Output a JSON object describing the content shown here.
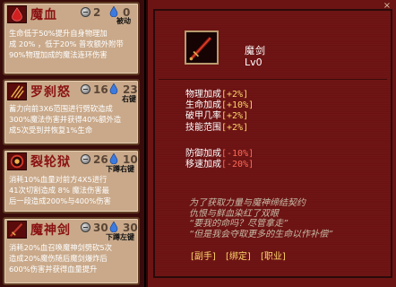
{
  "skills": [
    {
      "name": "魔血",
      "cost1": "2",
      "cost2": "0",
      "trigger": "被动",
      "desc": [
        "生命低于50%提升自身物理加",
        "成 20% ，低于20% 普攻额外附带",
        "90%物理加成的魔法连环伤害"
      ],
      "icon": "blood-drop-icon"
    },
    {
      "name": "罗刹怒",
      "cost1": "16",
      "cost2": "23",
      "trigger": "右键",
      "desc": [
        "蓄力向前3X6范围进行劈砍造成",
        "300%魔法伤害并获得40%额外造",
        "成5次受到并恢复1%生命"
      ],
      "icon": "claw-slash-icon"
    },
    {
      "name": "裂轮狱",
      "cost1": "26",
      "cost2": "10",
      "trigger": "下蹲右键",
      "desc": [
        "消耗10%血量对前方4X5进行",
        "41次切割造成 8% 魔法伤害最",
        "后一段造成200%与400%伤害"
      ],
      "icon": "spinning-wheel-icon"
    },
    {
      "name": "魔神剑",
      "cost1": "30",
      "cost2": "30",
      "trigger": "下蹲左键",
      "desc": [
        "消耗20%血召唤魔神剑劈砍5次",
        "造成20%魔伤随后魔剑爆炸后",
        "600%伤害并获得血量提升"
      ],
      "icon": "demon-sword-icon"
    }
  ],
  "item": {
    "name": "魔剑",
    "level": "Lv0",
    "stats_positive": [
      "物理加成[+2%]",
      "生命加成[+10%]",
      "破甲几率[+2%]",
      "技能范围[+2%]"
    ],
    "stats_negative": [
      "防御加成[-10%]",
      "移速加成[-20%]"
    ],
    "lore": [
      "为了获取力量与魔神缔结契约",
      "仇恨与鲜血染红了双眼",
      "“要我的命吗？尽管拿走”",
      "“但是我会夺取更多的生命以作补偿”"
    ],
    "tags": [
      "[副手]",
      "[绑定]",
      "[职业]"
    ],
    "close": "×"
  },
  "colors": {
    "card_bg": "#c9a98a",
    "skill_name": "#8a1212",
    "panel_bg": "#6c1414",
    "stat_positive": "#ffd66a",
    "stat_negative": "#ff6a5a",
    "lore": "#c7bca8"
  },
  "icons": {
    "cost1": "silver-coin-icon",
    "cost2": "blue-drop-icon",
    "weapon": "demon-sword-icon",
    "close": "close-icon"
  }
}
